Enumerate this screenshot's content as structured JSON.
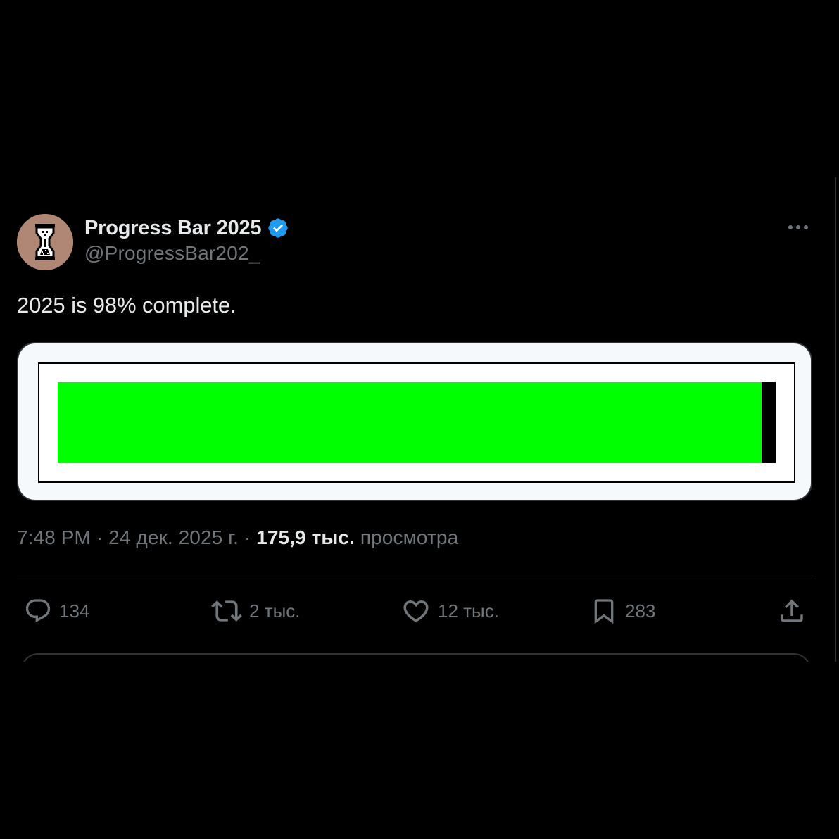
{
  "tweet": {
    "display_name": "Progress Bar 2025",
    "verified": true,
    "handle": "@ProgressBar202_",
    "more_icon": "more-horizontal-icon",
    "text": "2025 is 98% complete.",
    "media": {
      "progress_fraction": 0.98,
      "fill_color": "#00ff00",
      "empty_color": "#000000"
    },
    "meta": {
      "time": "7:48 PM",
      "separator": " · ",
      "date": "24 дек. 2025 г.",
      "views_count": "175,9 тыс.",
      "views_label": " просмотра"
    },
    "actions": {
      "reply": {
        "icon": "reply-icon",
        "count": "134"
      },
      "repost": {
        "icon": "repost-icon",
        "count": "2 тыс."
      },
      "like": {
        "icon": "heart-icon",
        "count": "12 тыс."
      },
      "bookmark": {
        "icon": "bookmark-icon",
        "count": "283"
      },
      "share": {
        "icon": "share-icon"
      }
    }
  },
  "colors": {
    "background": "#000000",
    "text_primary": "#e7e9ea",
    "text_secondary": "#71767b",
    "verified": "#1d9bf0",
    "divider": "#2f3336"
  }
}
